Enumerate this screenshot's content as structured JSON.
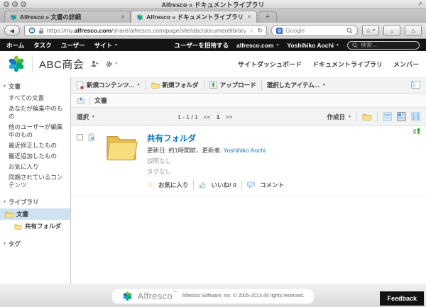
{
  "browser": {
    "window_title": "Alfresco » ドキュメントライブラリ",
    "tabs": [
      {
        "label": "Alfresco » 文書の詳細"
      },
      {
        "label": "Alfresco » ドキュメントライブラリ"
      }
    ],
    "url_prefix": "https://my.",
    "url_domain": "alfresco.com",
    "url_path": "/share/alfresco.com/page/site/abc/documentlibrary",
    "search_placeholder": "Google",
    "google_badge": "g"
  },
  "icons": {
    "caret": "▼",
    "close": "×",
    "new_tab": "+",
    "back": "◀",
    "download": "↓",
    "home": "⌂",
    "reload": "↻",
    "star": "☆",
    "fullscreen": "⇗"
  },
  "topnav": {
    "items": [
      "ホーム",
      "タスク",
      "ユーザー",
      "サイト"
    ],
    "invite": "ユーザーを招待する",
    "network": "alfresco.com",
    "user": "Yoshihiko Aochi",
    "search_placeholder": "検索..."
  },
  "site": {
    "title": "ABC商会",
    "links": [
      "サイトダッシュボード",
      "ドキュメントライブラリ",
      "メンバー"
    ]
  },
  "toolbar": {
    "new_content": "新規コンテンツ...",
    "new_folder": "新規フォルダ",
    "upload": "アップロード",
    "selected_items": "選択したアイテム..."
  },
  "breadcrumb": {
    "label": "文書"
  },
  "controls": {
    "select": "選択",
    "range": "1 - 1 / 1",
    "prev": "<<",
    "page": "1",
    "next": ">>",
    "sort": "作成日"
  },
  "sidebar": {
    "documents_header": "文書",
    "documents_items": [
      "すべての文書",
      "あなたが編集中のもの",
      "他のユーザーが編集中のもの",
      "最近修正したもの",
      "最近追加したもの",
      "お気に入り",
      "同期されているコンテンツ"
    ],
    "library_header": "ライブラリ",
    "library_root": "文書",
    "library_child": "共有フォルダ",
    "tags_header": "タグ"
  },
  "filelist": {
    "items": [
      {
        "name": "共有フォルダ",
        "meta_prefix": "更新日: 約1時間前、更新者: ",
        "modifier": "Yoshihiko Aochi",
        "description": "説明なし",
        "tags": "タグなし",
        "favorite": "お気に入り",
        "like": "いいね!",
        "like_count": "0",
        "comment": "コメント"
      }
    ]
  },
  "footer": {
    "brand": "Alfresco",
    "trademark": "™",
    "copyright": "Alfresco Software, Inc. © 2005-2013 All rights reserved.",
    "feedback": "Feedback"
  },
  "colors": {
    "link_blue": "#0e76bc",
    "nav_black": "#141414",
    "selection_blue": "#cfe2f1",
    "folder_yellow": "#f6d365"
  }
}
